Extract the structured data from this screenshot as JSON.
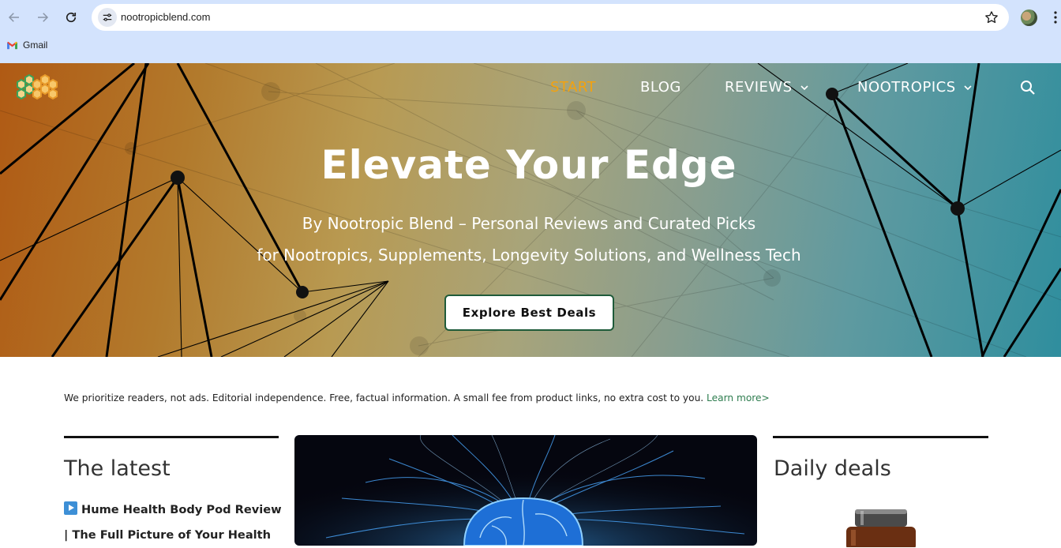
{
  "browser": {
    "url": "nootropicblend.com",
    "bookmarks": [
      {
        "label": "Gmail",
        "icon": "gmail-icon"
      }
    ]
  },
  "site": {
    "logo_icon": "hexagon-cluster-logo",
    "nav": [
      {
        "label": "START",
        "active": true,
        "has_dropdown": false
      },
      {
        "label": "BLOG",
        "active": false,
        "has_dropdown": false
      },
      {
        "label": "REVIEWS",
        "active": false,
        "has_dropdown": true
      },
      {
        "label": "NOOTROPICS",
        "active": false,
        "has_dropdown": true
      }
    ],
    "search_icon": "search-icon",
    "active_color": "#f3a20f"
  },
  "hero": {
    "title": "Elevate Your Edge",
    "subtitle_line1": "By Nootropic Blend – Personal Reviews and Curated Picks",
    "subtitle_line2": "for Nootropics, Supplements, Longevity Solutions, and Wellness Tech",
    "cta_label": "Explore Best Deals"
  },
  "disclaimer": {
    "text": "We prioritize readers, not ads. Editorial independence. Free, factual information. A small fee from product links, no extra cost to you. ",
    "link_label": "Learn more>"
  },
  "latest": {
    "title": "The latest",
    "post_title": "Hume Health Body Pod Review | The Full Picture of Your Health"
  },
  "featured": {
    "image_alt": "glowing blue brain with neural network"
  },
  "deals": {
    "title": "Daily deals"
  }
}
